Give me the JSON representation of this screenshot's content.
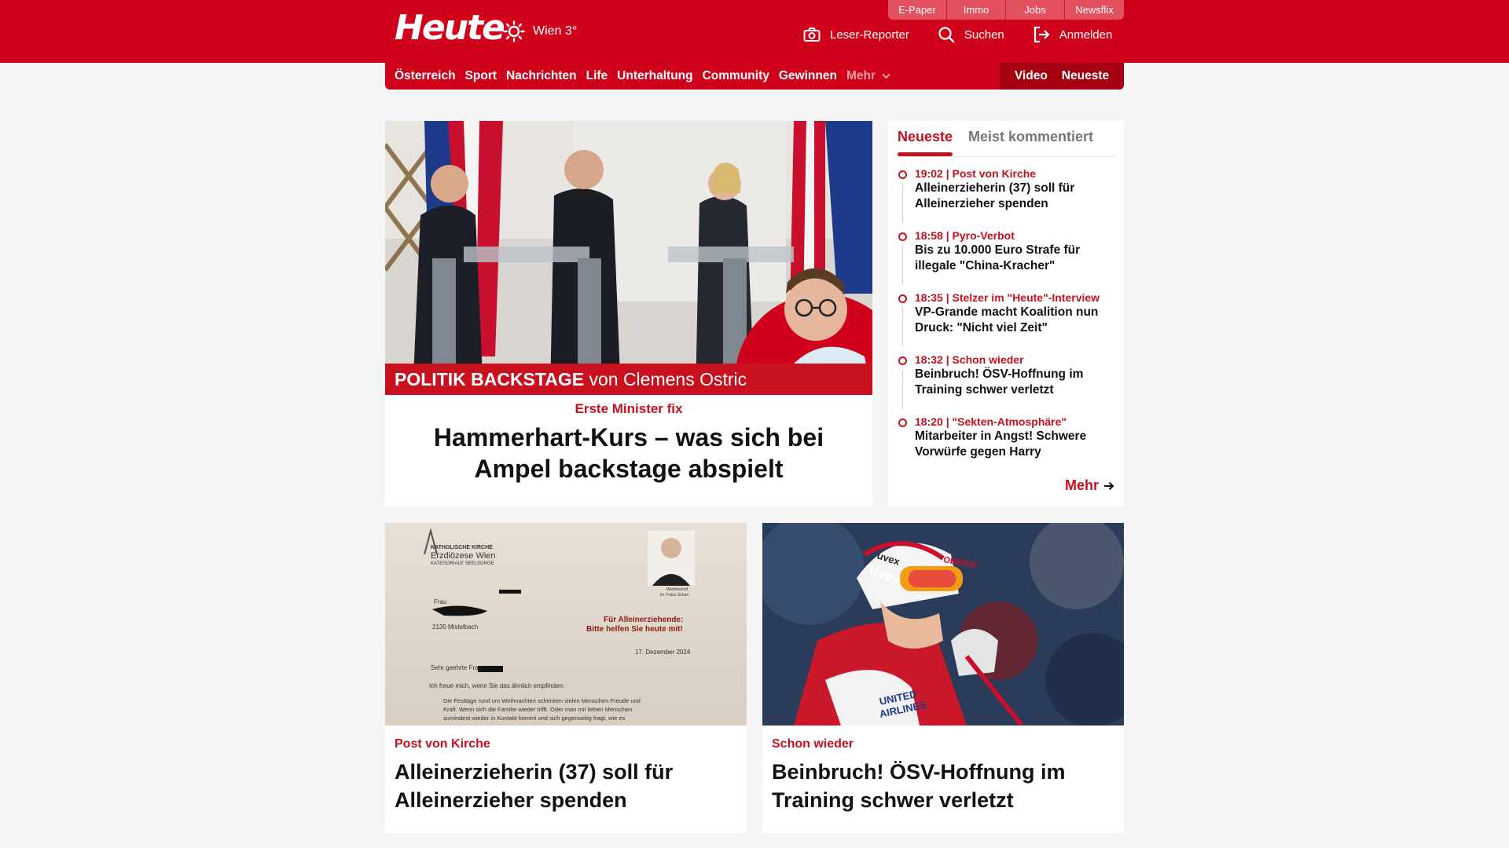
{
  "header": {
    "logo": "Heute",
    "weather_label": "Wien 3°",
    "top_links": [
      "E-Paper",
      "Immo",
      "Jobs",
      "Newsflix"
    ],
    "actions": {
      "reporter": "Leser-Reporter",
      "search": "Suchen",
      "login": "Anmelden"
    }
  },
  "nav": {
    "items": [
      "Österreich",
      "Sport",
      "Nachrichten",
      "Life",
      "Unterhaltung",
      "Community",
      "Gewinnen"
    ],
    "more": "Mehr",
    "video": "Video",
    "latest": "Neueste"
  },
  "hero": {
    "banner_bold": "POLITIK BACKSTAGE",
    "banner_rest": " von Clemens Ostric",
    "kicker": "Erste Minister fix",
    "title": "Hammerhart-Kurs – was sich bei Ampel backstage abspielt"
  },
  "sidebar": {
    "tabs": [
      "Neueste",
      "Meist kommentiert"
    ],
    "items": [
      {
        "meta": "19:02 | Post von Kirche",
        "title": "Alleinerzieherin (37) soll für Alleinerzieher spenden"
      },
      {
        "meta": "18:58 | Pyro-Verbot",
        "title": "Bis zu 10.000 Euro Strafe für illegale \"China-Kracher\""
      },
      {
        "meta": "18:35 | Stelzer im \"Heute\"-Interview",
        "title": "VP-Grande macht Koalition nun Druck: \"Nicht viel Zeit\""
      },
      {
        "meta": "18:32 | Schon wieder",
        "title": "Beinbruch! ÖSV-Hoffnung im Training schwer verletzt"
      },
      {
        "meta": "18:20 | \"Sekten-Atmosphäre\"",
        "title": "Mitarbeiter in Angst! Schwere Vorwürfe gegen Harry"
      }
    ],
    "more": "Mehr"
  },
  "cards": [
    {
      "kicker": "Post von Kirche",
      "title": "Alleinerzieherin (37) soll für Alleinerzieher spenden",
      "letter": {
        "org1": "KATHOLISCHE KIRCHE",
        "org2": "Erzdiözese Wien",
        "org3": "KATEGORIALE SEELSORGE",
        "salutation": "Frau",
        "city": "2130 Mistelbach",
        "appeal1": "Für Alleinerziehende:",
        "appeal2": "Bitte helfen Sie heute mit!",
        "date": "17. Dezember 2024",
        "greeting": "Sehr geehrte Frau",
        "line1": "Ich freue mich, wenn Sie das ähnlich empfinden:",
        "line2": "Die Festtage rund um Weihnachten schenken vielen Menschen Freude und",
        "line3": "Kraft. Wenn sich die Familie wieder trifft. Oder man mit lieben Menschen",
        "line4": "zumindest wieder in Kontakt kommt und sich gegenseitig fragt, wie es",
        "sign1": "Weihbischof",
        "sign2": "Dr. Franz Scharl"
      }
    },
    {
      "kicker": "Schon wieder",
      "title": "Beinbruch! ÖSV-Hoffnung im Training schwer verletzt",
      "photo_text": {
        "helmet1": "uvex",
        "helmet2": "uvex",
        "goggles": "OBERAI",
        "suit1": "UNITED",
        "suit2": "AIRLINES"
      }
    }
  ],
  "colors": {
    "brand_red": "#d0021b",
    "dark_red": "#a5000f",
    "kicker_red": "#c4111d",
    "page_bg": "#f5f5f5"
  }
}
